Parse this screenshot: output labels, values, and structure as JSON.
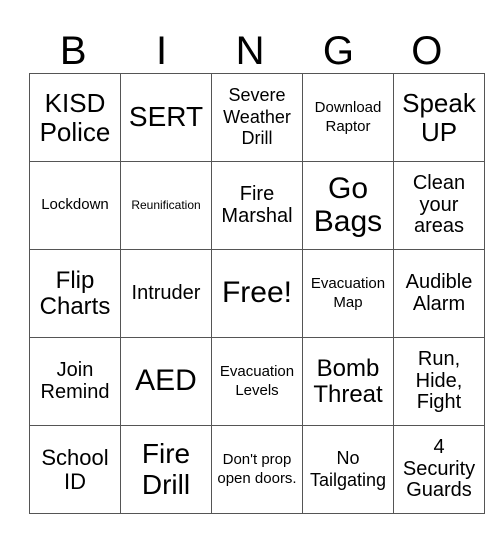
{
  "header": [
    "B",
    "I",
    "N",
    "G",
    "O"
  ],
  "rows": [
    [
      {
        "text": "KISD Police",
        "size": "s26"
      },
      {
        "text": "SERT",
        "size": "s28"
      },
      {
        "text": "Severe Weather Drill",
        "size": "s18"
      },
      {
        "text": "Download Raptor",
        "size": "s15"
      },
      {
        "text": "Speak UP",
        "size": "s26"
      }
    ],
    [
      {
        "text": "Lockdown",
        "size": "s15"
      },
      {
        "text": "Reunification",
        "size": "s12"
      },
      {
        "text": "Fire Marshal",
        "size": "s20"
      },
      {
        "text": "Go Bags",
        "size": "s30"
      },
      {
        "text": "Clean your areas",
        "size": "s20"
      }
    ],
    [
      {
        "text": "Flip Charts",
        "size": "s24"
      },
      {
        "text": "Intruder",
        "size": "s20"
      },
      {
        "text": "Free!",
        "size": "s30"
      },
      {
        "text": "Evacuation Map",
        "size": "s15"
      },
      {
        "text": "Audible Alarm",
        "size": "s20"
      }
    ],
    [
      {
        "text": "Join Remind",
        "size": "s20"
      },
      {
        "text": "AED",
        "size": "s30"
      },
      {
        "text": "Evacuation Levels",
        "size": "s15"
      },
      {
        "text": "Bomb Threat",
        "size": "s24"
      },
      {
        "text": "Run, Hide, Fight",
        "size": "s20"
      }
    ],
    [
      {
        "text": "School ID",
        "size": "s22"
      },
      {
        "text": "Fire Drill",
        "size": "s28"
      },
      {
        "text": "Don't prop open doors.",
        "size": "s15"
      },
      {
        "text": "No Tailgating",
        "size": "s18"
      },
      {
        "text": "4 Security Guards",
        "size": "s20"
      }
    ]
  ]
}
